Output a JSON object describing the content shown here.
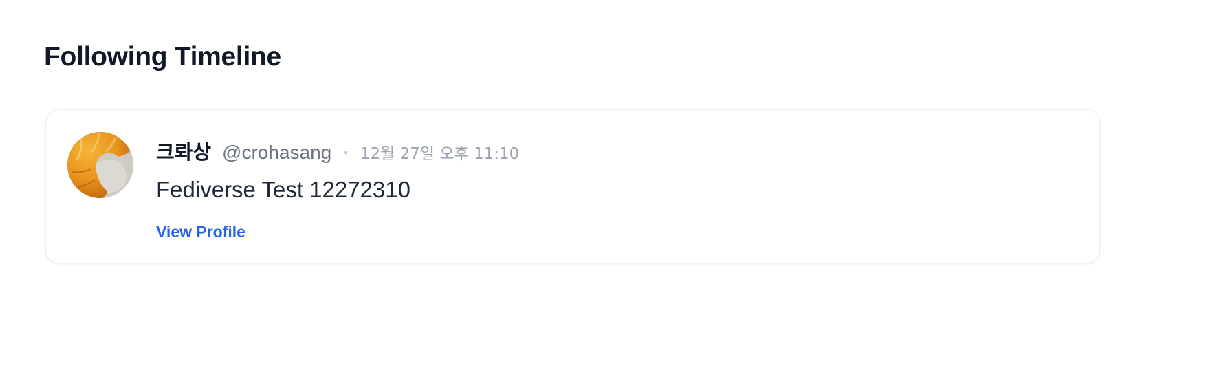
{
  "page": {
    "title": "Following Timeline"
  },
  "timeline": {
    "posts": [
      {
        "avatar_icon": "croissant-icon",
        "display_name": "크롸상",
        "handle": "@crohasang",
        "separator": "•",
        "timestamp": "12월 27일 오후 11:10",
        "content": "Fediverse Test 12272310",
        "link_label": "View Profile"
      }
    ]
  },
  "colors": {
    "link": "#2563eb",
    "muted_text": "#6b7280",
    "timestamp": "#9ca3af",
    "card_border": "#eceef1"
  }
}
